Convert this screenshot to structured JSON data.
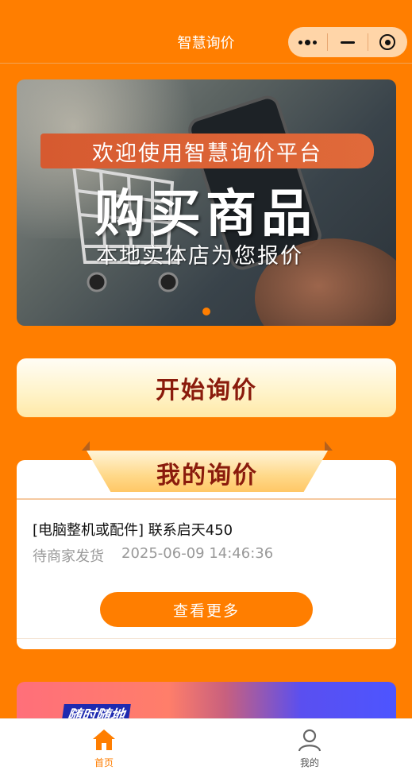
{
  "navbar": {
    "title": "智慧询价"
  },
  "banner": {
    "welcome_text": "欢迎使用智慧询价平台",
    "headline": "购买商品",
    "subline": "本地实体店为您报价"
  },
  "start_inquiry": {
    "label": "开始询价"
  },
  "my_inquiry": {
    "title": "我的询价",
    "items": [
      {
        "title": "[电脑整机或配件] 联系启天450",
        "status": "待商家发货",
        "time": "2025-06-09 14:46:36"
      }
    ],
    "more_label": "查看更多"
  },
  "promo": {
    "text": "随时随地"
  },
  "tabbar": {
    "items": [
      {
        "label": "首页",
        "icon": "home-icon",
        "active": true
      },
      {
        "label": "我的",
        "icon": "user-icon",
        "active": false
      }
    ]
  },
  "colors": {
    "primary": "#ff7e00",
    "title_red": "#8a1b0c"
  }
}
